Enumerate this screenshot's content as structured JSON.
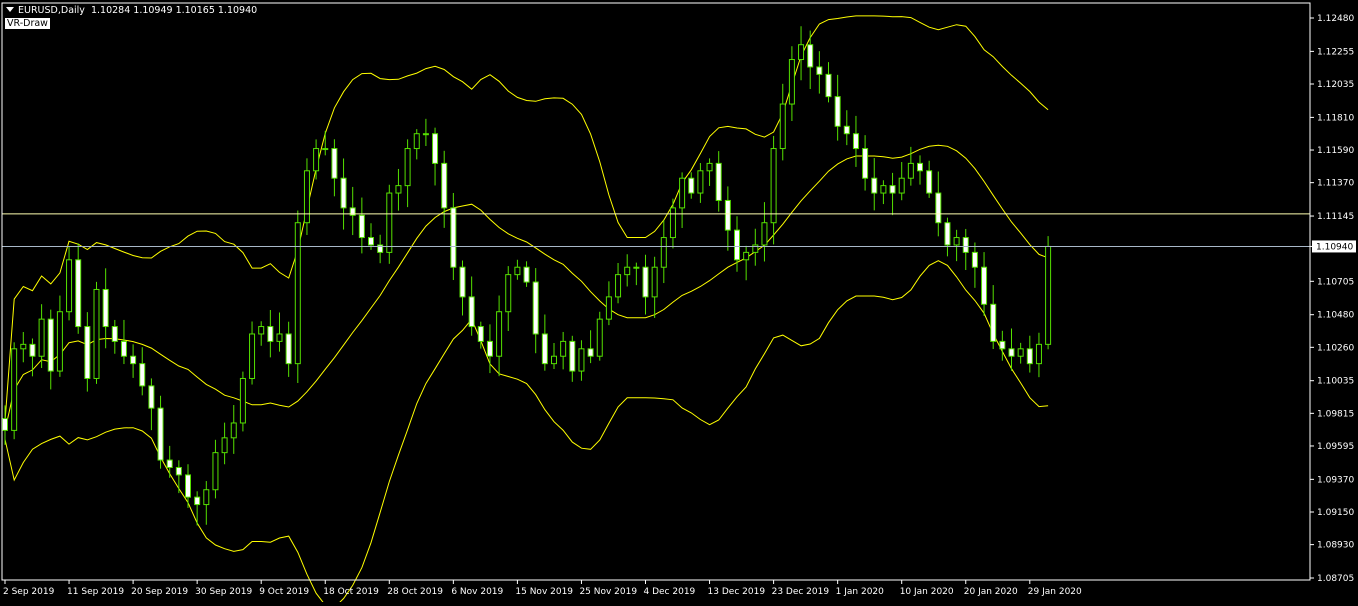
{
  "header": {
    "symbol": "EURUSD,Daily",
    "ohlc": "1.10284 1.10949 1.10165 1.10940"
  },
  "indicator_label": "VR-Draw",
  "colors": {
    "background": "#000000",
    "candle": "#55e000",
    "bull_body": "#000000",
    "bear_body": "#ffffff",
    "bands": "#ffff00",
    "frame": "#ffffff",
    "hline": "#ffffb0",
    "bid_line": "#a8b8c8",
    "price_tag_bg": "#ffffff"
  },
  "chart_data": {
    "type": "candlestick",
    "symbol": "EURUSD",
    "timeframe": "Daily",
    "price_axis_ticks": [
      "1.12480",
      "1.12255",
      "1.12035",
      "1.11810",
      "1.11590",
      "1.11370",
      "1.11145",
      "1.10940",
      "1.10705",
      "1.10480",
      "1.10260",
      "1.10035",
      "1.09815",
      "1.09595",
      "1.09370",
      "1.09150",
      "1.08930",
      "1.08705"
    ],
    "current_price": "1.10940",
    "horizontal_line": 1.1116,
    "ylim": [
      1.08705,
      1.1248
    ],
    "x_labels": [
      {
        "i": 0,
        "label": "2 Sep 2019"
      },
      {
        "i": 7,
        "label": "11 Sep 2019"
      },
      {
        "i": 14,
        "label": "20 Sep 2019"
      },
      {
        "i": 21,
        "label": "30 Sep 2019"
      },
      {
        "i": 28,
        "label": "9 Oct 2019"
      },
      {
        "i": 35,
        "label": "18 Oct 2019"
      },
      {
        "i": 42,
        "label": "28 Oct 2019"
      },
      {
        "i": 49,
        "label": "6 Nov 2019"
      },
      {
        "i": 56,
        "label": "15 Nov 2019"
      },
      {
        "i": 63,
        "label": "25 Nov 2019"
      },
      {
        "i": 70,
        "label": "4 Dec 2019"
      },
      {
        "i": 77,
        "label": "13 Dec 2019"
      },
      {
        "i": 84,
        "label": "23 Dec 2019"
      },
      {
        "i": 91,
        "label": "1 Jan 2020"
      },
      {
        "i": 98,
        "label": "10 Jan 2020"
      },
      {
        "i": 105,
        "label": "20 Jan 2020"
      },
      {
        "i": 112,
        "label": "29 Jan 2020"
      }
    ],
    "closes": [
      1.097,
      1.1025,
      1.1028,
      1.102,
      1.1045,
      1.101,
      1.105,
      1.1085,
      1.104,
      1.1005,
      1.1065,
      1.104,
      1.103,
      1.102,
      1.1015,
      1.1,
      1.0985,
      1.095,
      1.0945,
      1.094,
      1.0925,
      1.092,
      1.093,
      1.0955,
      1.0965,
      1.0975,
      1.1005,
      1.1035,
      1.104,
      1.103,
      1.1035,
      1.1015,
      1.111,
      1.1145,
      1.116,
      1.116,
      1.114,
      1.112,
      1.1115,
      1.11,
      1.1095,
      1.109,
      1.113,
      1.1135,
      1.116,
      1.117,
      1.117,
      1.115,
      1.112,
      1.108,
      1.106,
      1.104,
      1.103,
      1.102,
      1.105,
      1.1075,
      1.108,
      1.107,
      1.1035,
      1.1015,
      1.102,
      1.103,
      1.101,
      1.1025,
      1.102,
      1.1045,
      1.106,
      1.1075,
      1.108,
      1.108,
      1.106,
      1.108,
      1.11,
      1.112,
      1.114,
      1.113,
      1.1145,
      1.115,
      1.1125,
      1.1105,
      1.1085,
      1.109,
      1.1095,
      1.111,
      1.116,
      1.119,
      1.122,
      1.123,
      1.1215,
      1.121,
      1.1195,
      1.1175,
      1.117,
      1.116,
      1.114,
      1.113,
      1.1135,
      1.113,
      1.114,
      1.115,
      1.1145,
      1.113,
      1.111,
      1.1095,
      1.11,
      1.109,
      1.108,
      1.1055,
      1.103,
      1.1025,
      1.102,
      1.1025,
      1.1015,
      1.1028,
      1.1094
    ],
    "bands": {
      "description": "Bollinger bands (upper, middle, lower) drawn as yellow lines"
    }
  }
}
